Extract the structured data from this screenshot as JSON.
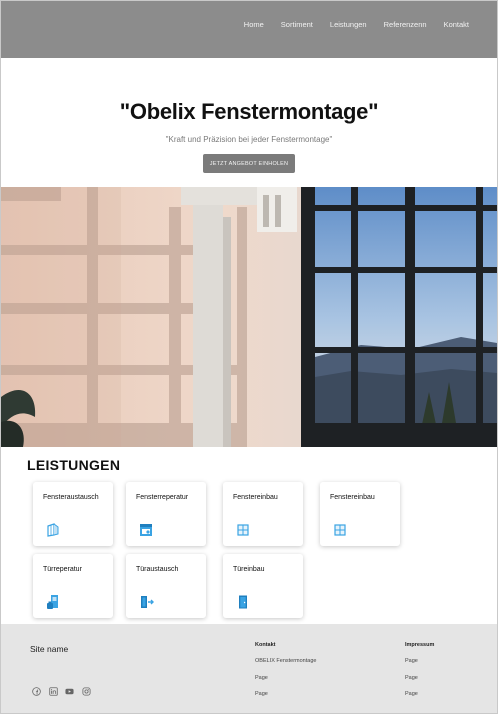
{
  "nav": {
    "items": [
      "Home",
      "Sortiment",
      "Leistungen",
      "Referenzenn",
      "Kontakt"
    ]
  },
  "hero": {
    "title": "\"Obelix Fenstermontage\"",
    "subtitle": "\"Kraft und Präzision bei jeder Fenstermontage\"",
    "cta_label": "JETZT ANGEBOT EINHOLEN"
  },
  "services": {
    "title": "LEISTUNGEN",
    "cards": [
      {
        "label": "Fensteraustausch",
        "icon": "window-swap-icon"
      },
      {
        "label": "Fensterreperatur",
        "icon": "window-repair-icon"
      },
      {
        "label": "Fenstereinbau",
        "icon": "window-icon"
      },
      {
        "label": "Fenstereinbau",
        "icon": "window-icon"
      },
      {
        "label": "Türreperatur",
        "icon": "door-repair-icon"
      },
      {
        "label": "Türaustausch",
        "icon": "door-exit-icon"
      },
      {
        "label": "Türeinbau",
        "icon": "door-icon"
      }
    ]
  },
  "footer": {
    "site_name": "Site name",
    "social": [
      "facebook-icon",
      "linkedin-icon",
      "youtube-icon",
      "instagram-icon"
    ],
    "col1": {
      "title": "Kontakt",
      "items": [
        "OBELIX Fenstermontage",
        "Page",
        "Page"
      ]
    },
    "col2": {
      "title": "Impressum",
      "items": [
        "Page",
        "Page",
        "Page"
      ]
    }
  },
  "colors": {
    "header_bg": "#8c8c8c",
    "cta_bg": "#7b7b7b",
    "icon_blue": "#3aa3e3",
    "footer_bg": "#e5e5e5"
  }
}
